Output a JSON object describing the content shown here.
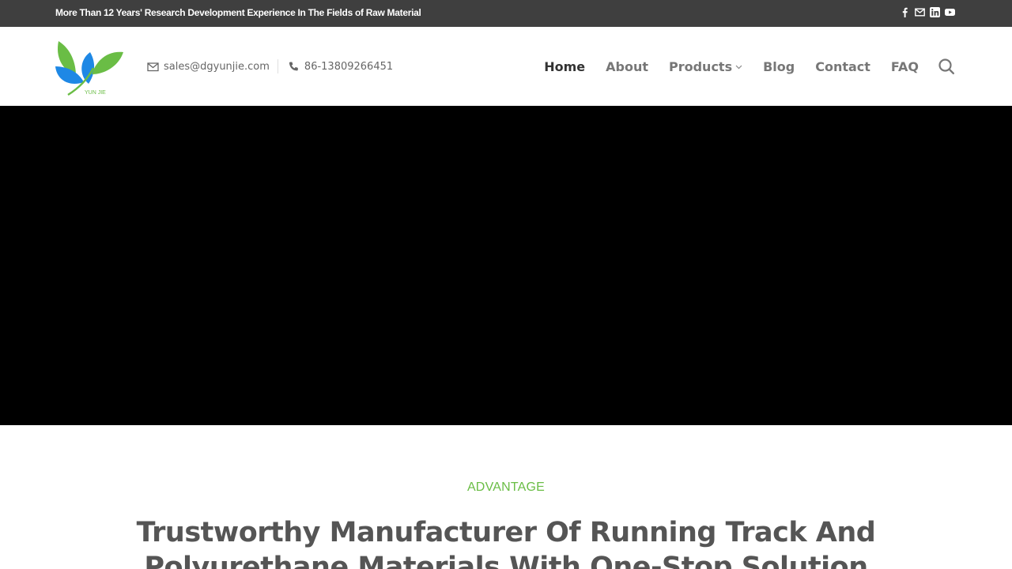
{
  "topbar": {
    "tagline": "More Than 12 Years' Research Development Experience In The Fields of Raw Material",
    "social_icons": [
      "facebook-icon",
      "email-icon",
      "linkedin-icon",
      "youtube-icon"
    ]
  },
  "header": {
    "logo_text": "YUN JIE",
    "email": "sales@dgyunjie.com",
    "phone": "86-13809266451",
    "nav": [
      {
        "label": "Home",
        "active": true
      },
      {
        "label": "About",
        "active": false
      },
      {
        "label": "Products",
        "active": false,
        "has_dropdown": true
      },
      {
        "label": "Blog",
        "active": false
      },
      {
        "label": "Contact",
        "active": false
      },
      {
        "label": "FAQ",
        "active": false
      }
    ]
  },
  "section": {
    "eyebrow": "ADVANTAGE",
    "title": "Trustworthy Manufacturer Of Running Track And Polyurethane Materials With One-Stop Solution"
  },
  "colors": {
    "topbar_bg": "#3f3f3f",
    "accent_green": "#6abd45",
    "logo_blue": "#1e88e5",
    "hero_bg": "#000000"
  }
}
